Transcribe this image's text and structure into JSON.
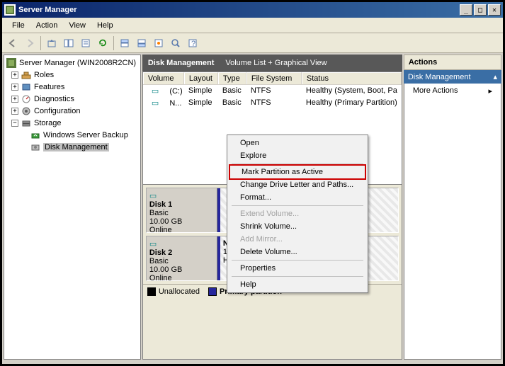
{
  "window": {
    "title": "Server Manager"
  },
  "menus": {
    "file": "File",
    "action": "Action",
    "view": "View",
    "help": "Help"
  },
  "tree": {
    "root": "Server Manager (WIN2008R2CN)",
    "roles": "Roles",
    "features": "Features",
    "diagnostics": "Diagnostics",
    "configuration": "Configuration",
    "storage": "Storage",
    "backup": "Windows Server Backup",
    "diskmgmt": "Disk Management"
  },
  "center": {
    "title": "Disk Management",
    "subtitle": "Volume List + Graphical View",
    "cols": {
      "vol": "Volume",
      "lay": "Layout",
      "typ": "Type",
      "fs": "File System",
      "st": "Status"
    },
    "rows": [
      {
        "vol": "(C:)",
        "lay": "Simple",
        "typ": "Basic",
        "fs": "NTFS",
        "st": "Healthy (System, Boot, Pa"
      },
      {
        "vol": "N...",
        "lay": "Simple",
        "typ": "Basic",
        "fs": "NTFS",
        "st": "Healthy (Primary Partition)"
      }
    ],
    "disks": [
      {
        "name": "Disk 1",
        "type": "Basic",
        "size": "10.00 GB",
        "status": "Online"
      },
      {
        "name": "Disk 2",
        "type": "Basic",
        "size": "10.00 GB",
        "status": "Online",
        "part": {
          "name": "New Volume  (D:)",
          "size": "10.00 GB NTFS",
          "status": "Healthy (Primary Partition)"
        }
      }
    ],
    "legend": {
      "unalloc": "Unallocated",
      "primary": "Primary partition"
    }
  },
  "actions": {
    "title": "Actions",
    "section": "Disk Management",
    "more": "More Actions"
  },
  "context": {
    "open": "Open",
    "explore": "Explore",
    "mark_active": "Mark Partition as Active",
    "change_letter": "Change Drive Letter and Paths...",
    "format": "Format...",
    "extend": "Extend Volume...",
    "shrink": "Shrink Volume...",
    "mirror": "Add Mirror...",
    "delete": "Delete Volume...",
    "properties": "Properties",
    "help": "Help"
  }
}
